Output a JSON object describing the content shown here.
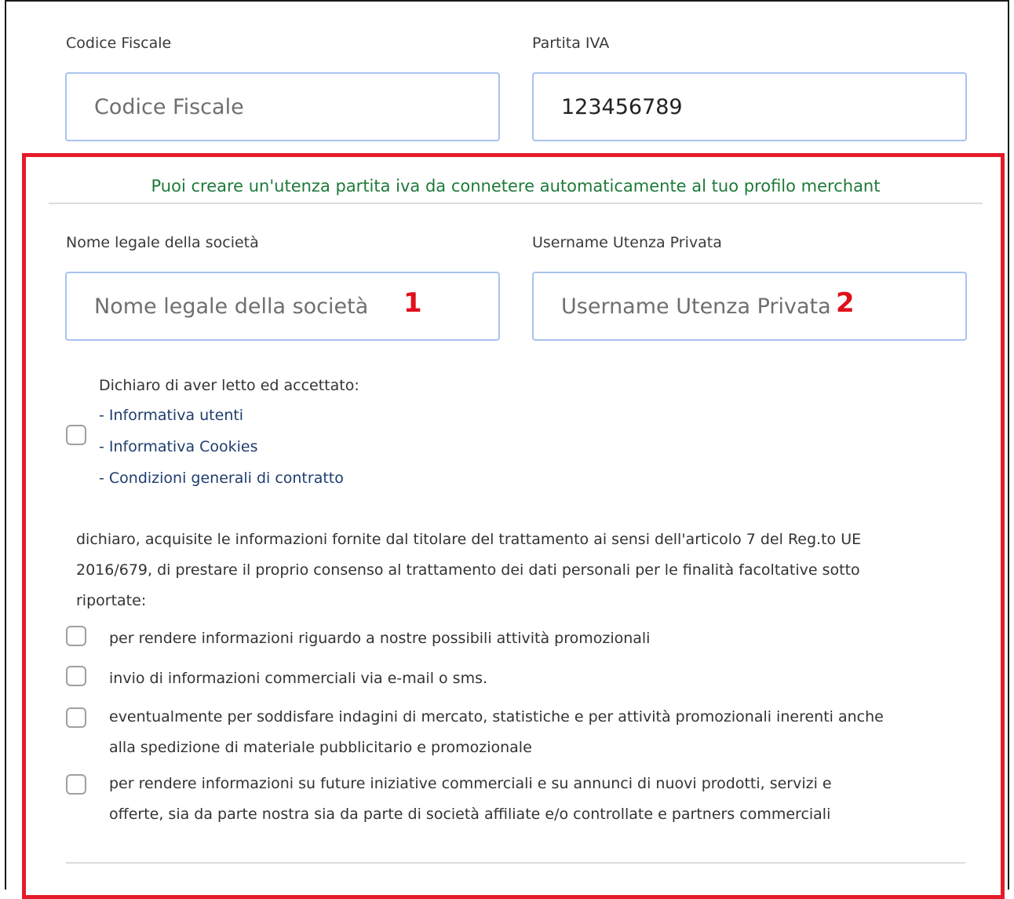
{
  "fields": {
    "codice_fiscale": {
      "label": "Codice Fiscale",
      "placeholder": "Codice Fiscale",
      "value": ""
    },
    "partita_iva": {
      "label": "Partita IVA",
      "value": "123456789"
    },
    "nome_legale": {
      "label": "Nome legale della società",
      "placeholder": "Nome legale della società",
      "marker": "1"
    },
    "username": {
      "label": "Username Utenza Privata",
      "placeholder": "Username Utenza Privata",
      "marker": "2"
    }
  },
  "info_message": "Puoi creare un'utenza partita iva da connetere automaticamente al tuo profilo merchant",
  "terms": {
    "heading": "Dichiaro di aver letto ed accettato:",
    "links": [
      "- Informativa utenti",
      "- Informativa Cookies",
      "- Condizioni generali di contratto"
    ]
  },
  "consent": {
    "lines": [
      "dichiaro, acquisite le informazioni fornite dal titolare del trattamento ai sensi dell'articolo 7 del Reg.to UE",
      "2016/679, di prestare il proprio consenso al trattamento dei dati personali per le finalità facoltative sotto",
      "riportate:"
    ],
    "options": [
      {
        "lines": [
          "per rendere informazioni riguardo a nostre possibili attività promozionali"
        ]
      },
      {
        "lines": [
          "invio di informazioni commerciali via e-mail o sms."
        ]
      },
      {
        "lines": [
          "eventualmente per soddisfare indagini di mercato, statistiche e per attività promozionali inerenti anche",
          "alla spedizione di materiale pubblicitario e promozionale"
        ]
      },
      {
        "lines": [
          "per rendere informazioni su future iniziative commerciali e su annunci di nuovi prodotti, servizi e",
          "offerte, sia da parte nostra sia da parte di società affiliate e/o controllate e partners commerciali"
        ]
      }
    ]
  },
  "colors": {
    "highlight": "#e51b2a",
    "marker": "#e0101b",
    "info": "#1e7a3a",
    "input_border": "#a9c3ee"
  }
}
